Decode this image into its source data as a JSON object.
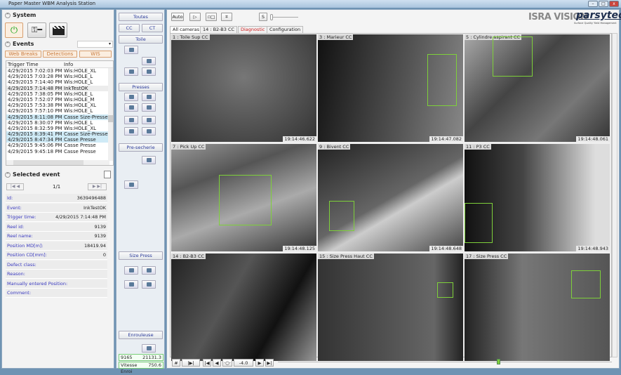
{
  "window": {
    "title": "Paper Master WBM Analysis Station"
  },
  "system": {
    "title": "System",
    "buttons": [
      {
        "icon": "power-icon"
      },
      {
        "icon": "key-icon"
      },
      {
        "icon": "clapperboard-icon"
      }
    ]
  },
  "events": {
    "title": "Events",
    "dropdown_value": "",
    "filters": [
      "Web Breaks",
      "Detections",
      "WIS"
    ],
    "columns": [
      "Trigger Time",
      "Info"
    ],
    "rows": [
      [
        "4/29/2015 7:02:03 PM",
        "Wis:HOLE_XL",
        ""
      ],
      [
        "4/29/2015 7:03:28 PM",
        "Wis:HOLE_L",
        ""
      ],
      [
        "4/29/2015 7:14:40 PM",
        "Wis:HOLE_L",
        ""
      ],
      [
        "4/29/2015 7:14:48 PM",
        "InkTestOK",
        "selected"
      ],
      [
        "4/29/2015 7:38:05 PM",
        "Wis:HOLE_L",
        ""
      ],
      [
        "4/29/2015 7:52:07 PM",
        "Wis:HOLE_M",
        ""
      ],
      [
        "4/29/2015 7:53:38 PM",
        "Wis:HOLE_XL",
        ""
      ],
      [
        "4/29/2015 7:57:10 PM",
        "Wis:HOLE_L",
        ""
      ],
      [
        "4/29/2015 8:11:08 PM",
        "Casse Size-Presse",
        "break"
      ],
      [
        "4/29/2015 8:30:07 PM",
        "Wis:HOLE_L",
        ""
      ],
      [
        "4/29/2015 8:32:59 PM",
        "Wis:HOLE_XL",
        ""
      ],
      [
        "4/29/2015 8:39:41 PM",
        "Casse Size-Presse",
        "break"
      ],
      [
        "4/29/2015 8:47:34 PM",
        "Casse Presse",
        "break"
      ],
      [
        "4/29/2015 9:45:06 PM",
        "Casse Presse",
        ""
      ],
      [
        "4/29/2015 9:45:18 PM",
        "Casse Presse",
        ""
      ]
    ]
  },
  "selected_event": {
    "title": "Selected event",
    "page": "1/1",
    "fields": [
      [
        "Id:",
        "3639496488"
      ],
      [
        "Event:",
        "InkTestOK"
      ],
      [
        "Trigger time:",
        "4/29/2015 7:14:48 PM"
      ],
      [
        "Reel id:",
        "9139"
      ],
      [
        "Reel name:",
        "9139"
      ],
      [
        "Position MD[m]:",
        "18419.94"
      ],
      [
        "Position CD[mm]:",
        "0"
      ],
      [
        "Defect class:",
        ""
      ],
      [
        "Reason:",
        ""
      ],
      [
        "Manually entered Position:",
        ""
      ],
      [
        "Comment:",
        ""
      ]
    ]
  },
  "groups": {
    "toutes": "Toutes",
    "cc": "CC",
    "ct": "CT",
    "toile": "Toile",
    "presses": "Presses",
    "presecherie": "Pre-secherie",
    "sizepress": "Size Press",
    "enrouleuse": "Enrouleuse"
  },
  "readouts": {
    "reel": "9165",
    "position": "21131.3",
    "speed_label": "Vitesse Enroi",
    "speed": "750.6"
  },
  "toolbar": {
    "auto": "Auto",
    "s": "S"
  },
  "tabs": [
    {
      "label": "All cameras",
      "active": true
    },
    {
      "label": "14 : B2-B3 CC"
    },
    {
      "label": "Diagnostic",
      "color": "#d02020"
    },
    {
      "label": "Configuration"
    }
  ],
  "logo": {
    "isra": "ISRA VISION",
    "parsytec": "parsytec",
    "tagline": "Surface Quality Yield Management"
  },
  "cameras": [
    {
      "label": "1 : Toile Sup CC",
      "time": "19:14:46.622"
    },
    {
      "label": "3 : Marieur CC",
      "time": "19:14:47.082"
    },
    {
      "label": "5 : Cylindre aspirant CC",
      "time": "19:14:48.061"
    },
    {
      "label": "7 : Pick Up CC",
      "time": "19:14:48.125"
    },
    {
      "label": "9 : Bivent CC",
      "time": "19:14:48.648"
    },
    {
      "label": "11 : P3 CC",
      "time": "19:14:48.943"
    },
    {
      "label": "14 : B2-B3 CC",
      "time": ""
    },
    {
      "label": "15 : Size Press Haut CC",
      "time": ""
    },
    {
      "label": "17 : Size Press CC",
      "time": ""
    }
  ],
  "playback": {
    "hash": "#",
    "play_marker": "|▶|",
    "first": "|◀",
    "prev": "◀",
    "center": "·○·",
    "step": "-4.0",
    "next": "▶",
    "last": "▶|"
  },
  "colors": {
    "detection_box": "#7ed03a",
    "break_row": "#cfeaf6",
    "accent_orange": "#c8783a"
  }
}
